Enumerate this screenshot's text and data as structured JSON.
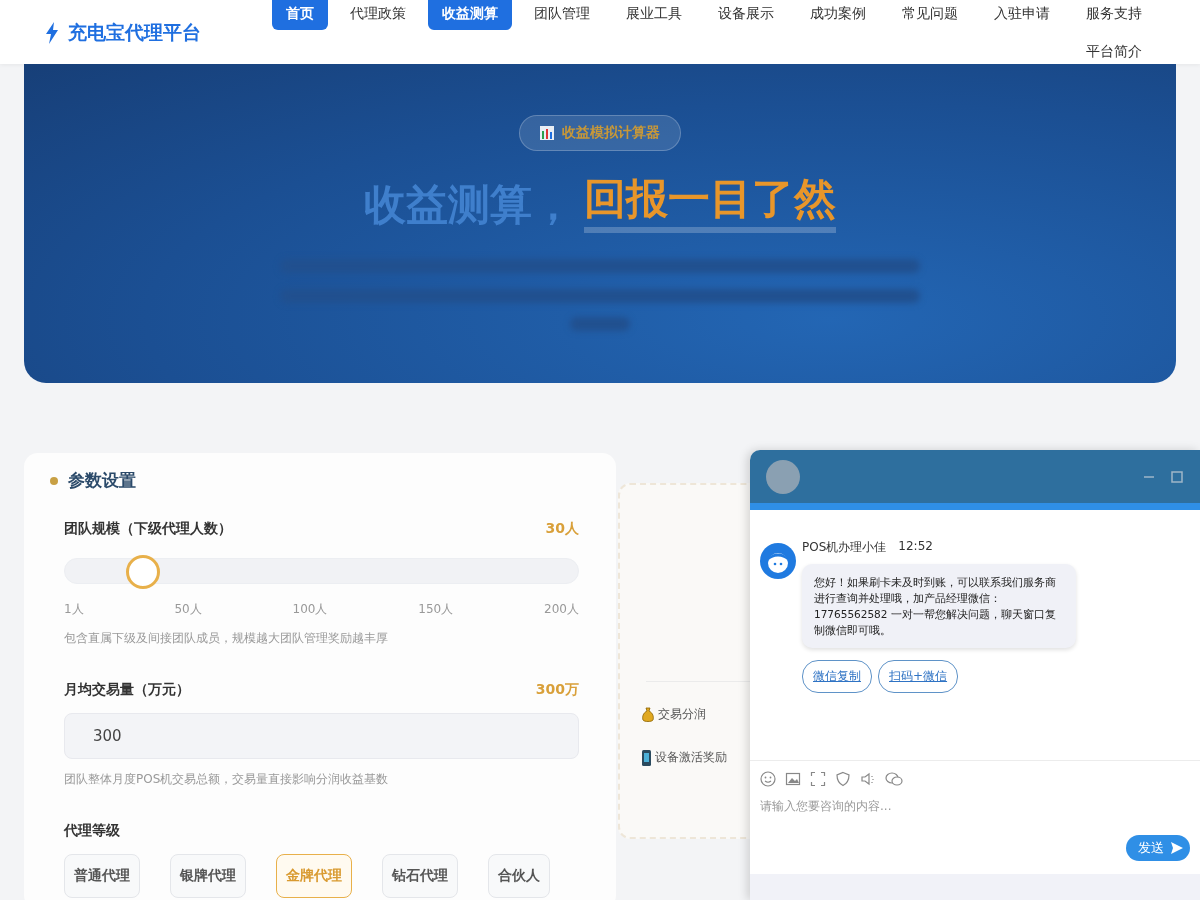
{
  "header": {
    "brand": "充电宝代理平台"
  },
  "nav": [
    {
      "label": "首页",
      "selected": true
    },
    {
      "label": "代理政策",
      "selected": false
    },
    {
      "label": "收益测算",
      "selected": true
    },
    {
      "label": "团队管理",
      "selected": false
    },
    {
      "label": "展业工具",
      "selected": false
    },
    {
      "label": "设备展示",
      "selected": false
    },
    {
      "label": "成功案例",
      "selected": false
    },
    {
      "label": "常见问题",
      "selected": false
    },
    {
      "label": "入驻申请",
      "selected": false
    },
    {
      "label": "服务支持",
      "selected": false
    },
    {
      "label": "平台简介",
      "selected": false
    }
  ],
  "hero": {
    "badge": "收益模拟计算器",
    "title_plain": "收益测算，",
    "title_highlight": "回报一目了然"
  },
  "params": {
    "heading": "参数设置",
    "team": {
      "label": "团队规模（下级代理人数）",
      "value": "30人",
      "level": 0.15,
      "ticks": [
        "1人",
        "50人",
        "100人",
        "150人",
        "200人"
      ],
      "hint": "包含直属下级及间接团队成员，规模越大团队管理奖励越丰厚"
    },
    "volume": {
      "label": "月均交易量（万元）",
      "value": "300万",
      "input": "300",
      "hint": "团队整体月度POS机交易总额，交易量直接影响分润收益基数"
    },
    "tier": {
      "label": "代理等级",
      "options": [
        {
          "label": "普通代理",
          "selected": false
        },
        {
          "label": "银牌代理",
          "selected": false
        },
        {
          "label": "金牌代理",
          "selected": true
        },
        {
          "label": "钻石代理",
          "selected": false
        },
        {
          "label": "合伙人",
          "selected": false
        }
      ]
    }
  },
  "rewards": [
    {
      "label": "交易分润",
      "kind": "coin"
    },
    {
      "label": "设备激活奖励",
      "kind": "device"
    }
  ],
  "chat": {
    "agent": "POS机办理小佳",
    "time": "12:52",
    "message": "您好！如果刷卡未及时到账，可以联系我们服务商进行查询并处理哦，加产品经理微信：17765562582 一对一帮您解决问题，聊天窗口复制微信即可哦。",
    "actions": [
      "微信复制",
      "扫码+微信"
    ],
    "placeholder": "请输入您要咨询的内容...",
    "send": "发送"
  }
}
